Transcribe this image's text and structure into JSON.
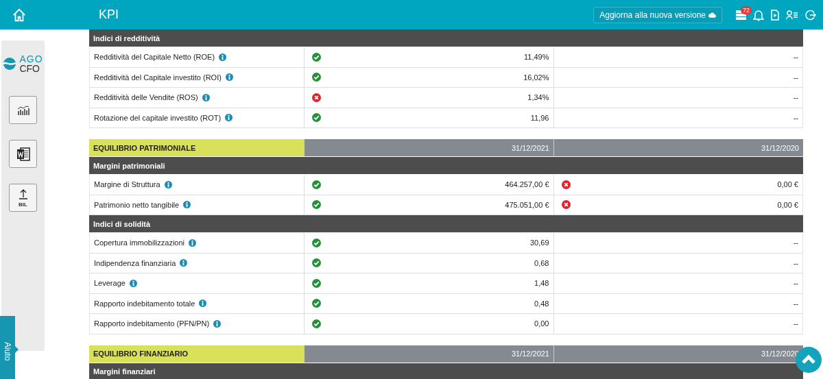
{
  "header": {
    "title": "KPI",
    "update_button": "Aggiorna alla nuova versione",
    "badge": "72"
  },
  "sidebar": {
    "logo_top": "AGO",
    "logo_bottom": "CFO",
    "tools": [
      {
        "kind": "chart"
      },
      {
        "kind": "word"
      },
      {
        "kind": "upload",
        "label": "BIL"
      }
    ]
  },
  "help_tab": "Aiuto",
  "blocks": [
    {
      "kind": "subheader",
      "title": "Indici di redditività"
    },
    {
      "kind": "row",
      "label": "Redditività del Capitale Netto (ROE)",
      "passed": true,
      "value": "11,49%",
      "value_2": "--"
    },
    {
      "kind": "row",
      "label": "Redditività del Capitale investito (ROI)",
      "passed": true,
      "value": "16,02%",
      "value_2": "--"
    },
    {
      "kind": "row",
      "label": "Redditività delle Vendite (ROS)",
      "passed": false,
      "value": "1,34%",
      "value_2": "--"
    },
    {
      "kind": "row",
      "label": "Rotazione del capitale investito (ROT)",
      "passed": true,
      "value": "11,96",
      "value_2": "--"
    },
    {
      "kind": "group",
      "title": "EQUILIBRIO PATRIMONIALE",
      "column_2": "31/12/2021",
      "column_3": "31/12/2020"
    },
    {
      "kind": "subheader",
      "title": "Margini patrimoniali"
    },
    {
      "kind": "row",
      "label": "Margine di Struttura",
      "passed": true,
      "value": "464.257,00 €",
      "passed_2": false,
      "value_2": "0,00 €"
    },
    {
      "kind": "row",
      "label": "Patrimonio netto tangibile",
      "passed": true,
      "value": "475.051,00 €",
      "passed_2": false,
      "value_2": "0,00 €"
    },
    {
      "kind": "subheader",
      "title": "Indici di solidità"
    },
    {
      "kind": "row",
      "label": "Copertura immobilizzazioni",
      "passed": true,
      "value": "30,69",
      "value_2": "--"
    },
    {
      "kind": "row",
      "label": "Indipendenza finanziaria",
      "passed": true,
      "value": "0,68",
      "value_2": "--"
    },
    {
      "kind": "row",
      "label": "Leverage",
      "passed": true,
      "value": "1,48",
      "value_2": "--"
    },
    {
      "kind": "row",
      "label": "Rapporto indebitamento totale",
      "passed": true,
      "value": "0,48",
      "value_2": "--"
    },
    {
      "kind": "row",
      "label": "Rapporto indebitamento (PFN/PN)",
      "passed": true,
      "value": "0,00",
      "value_2": "--"
    },
    {
      "kind": "group",
      "title": "EQUILIBRIO FINANZIARIO",
      "column_2": "31/12/2021",
      "column_3": "31/12/2020"
    },
    {
      "kind": "subheader",
      "title": "Margini finanziari"
    }
  ]
}
